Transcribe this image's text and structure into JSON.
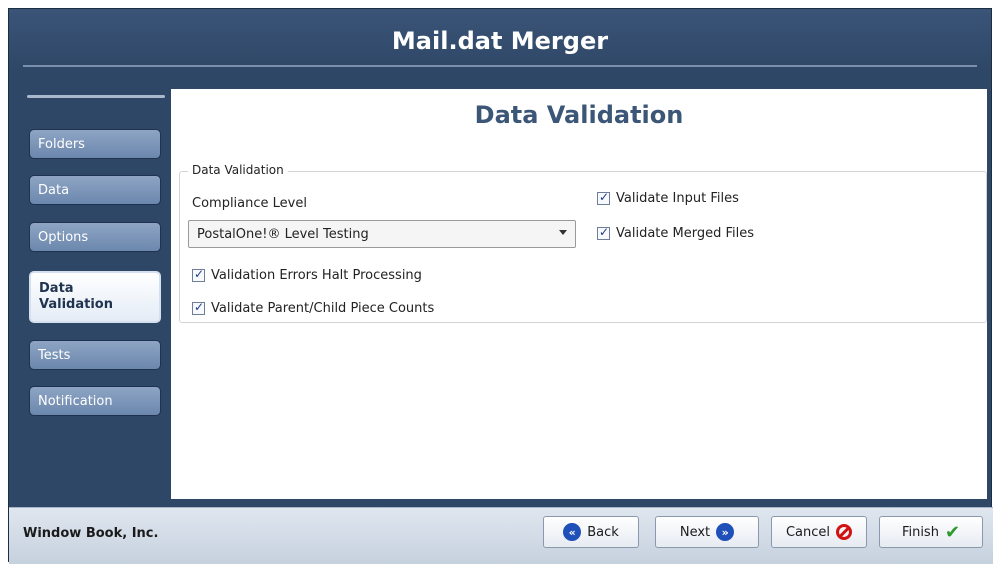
{
  "app": {
    "title": "Mail.dat Merger"
  },
  "sidebar": {
    "items": [
      {
        "label": "Folders"
      },
      {
        "label": "Data"
      },
      {
        "label": "Options"
      },
      {
        "label": "Data Validation"
      },
      {
        "label": "Tests"
      },
      {
        "label": "Notification"
      }
    ],
    "active_index": 3
  },
  "main": {
    "heading": "Data Validation",
    "group_title": "Data Validation",
    "compliance_label": "Compliance Level",
    "compliance_value": "PostalOne!® Level Testing",
    "checks": {
      "halt": {
        "label": "Validation Errors Halt Processing",
        "checked": true
      },
      "piece_counts": {
        "label": "Validate Parent/Child Piece Counts",
        "checked": true
      },
      "input_files": {
        "label": "Validate Input Files",
        "checked": true
      },
      "merged_files": {
        "label": "Validate Merged Files",
        "checked": true
      }
    }
  },
  "footer": {
    "company": "Window Book, Inc.",
    "back_label": "Back",
    "next_label": "Next",
    "cancel_label": "Cancel",
    "finish_label": "Finish"
  }
}
